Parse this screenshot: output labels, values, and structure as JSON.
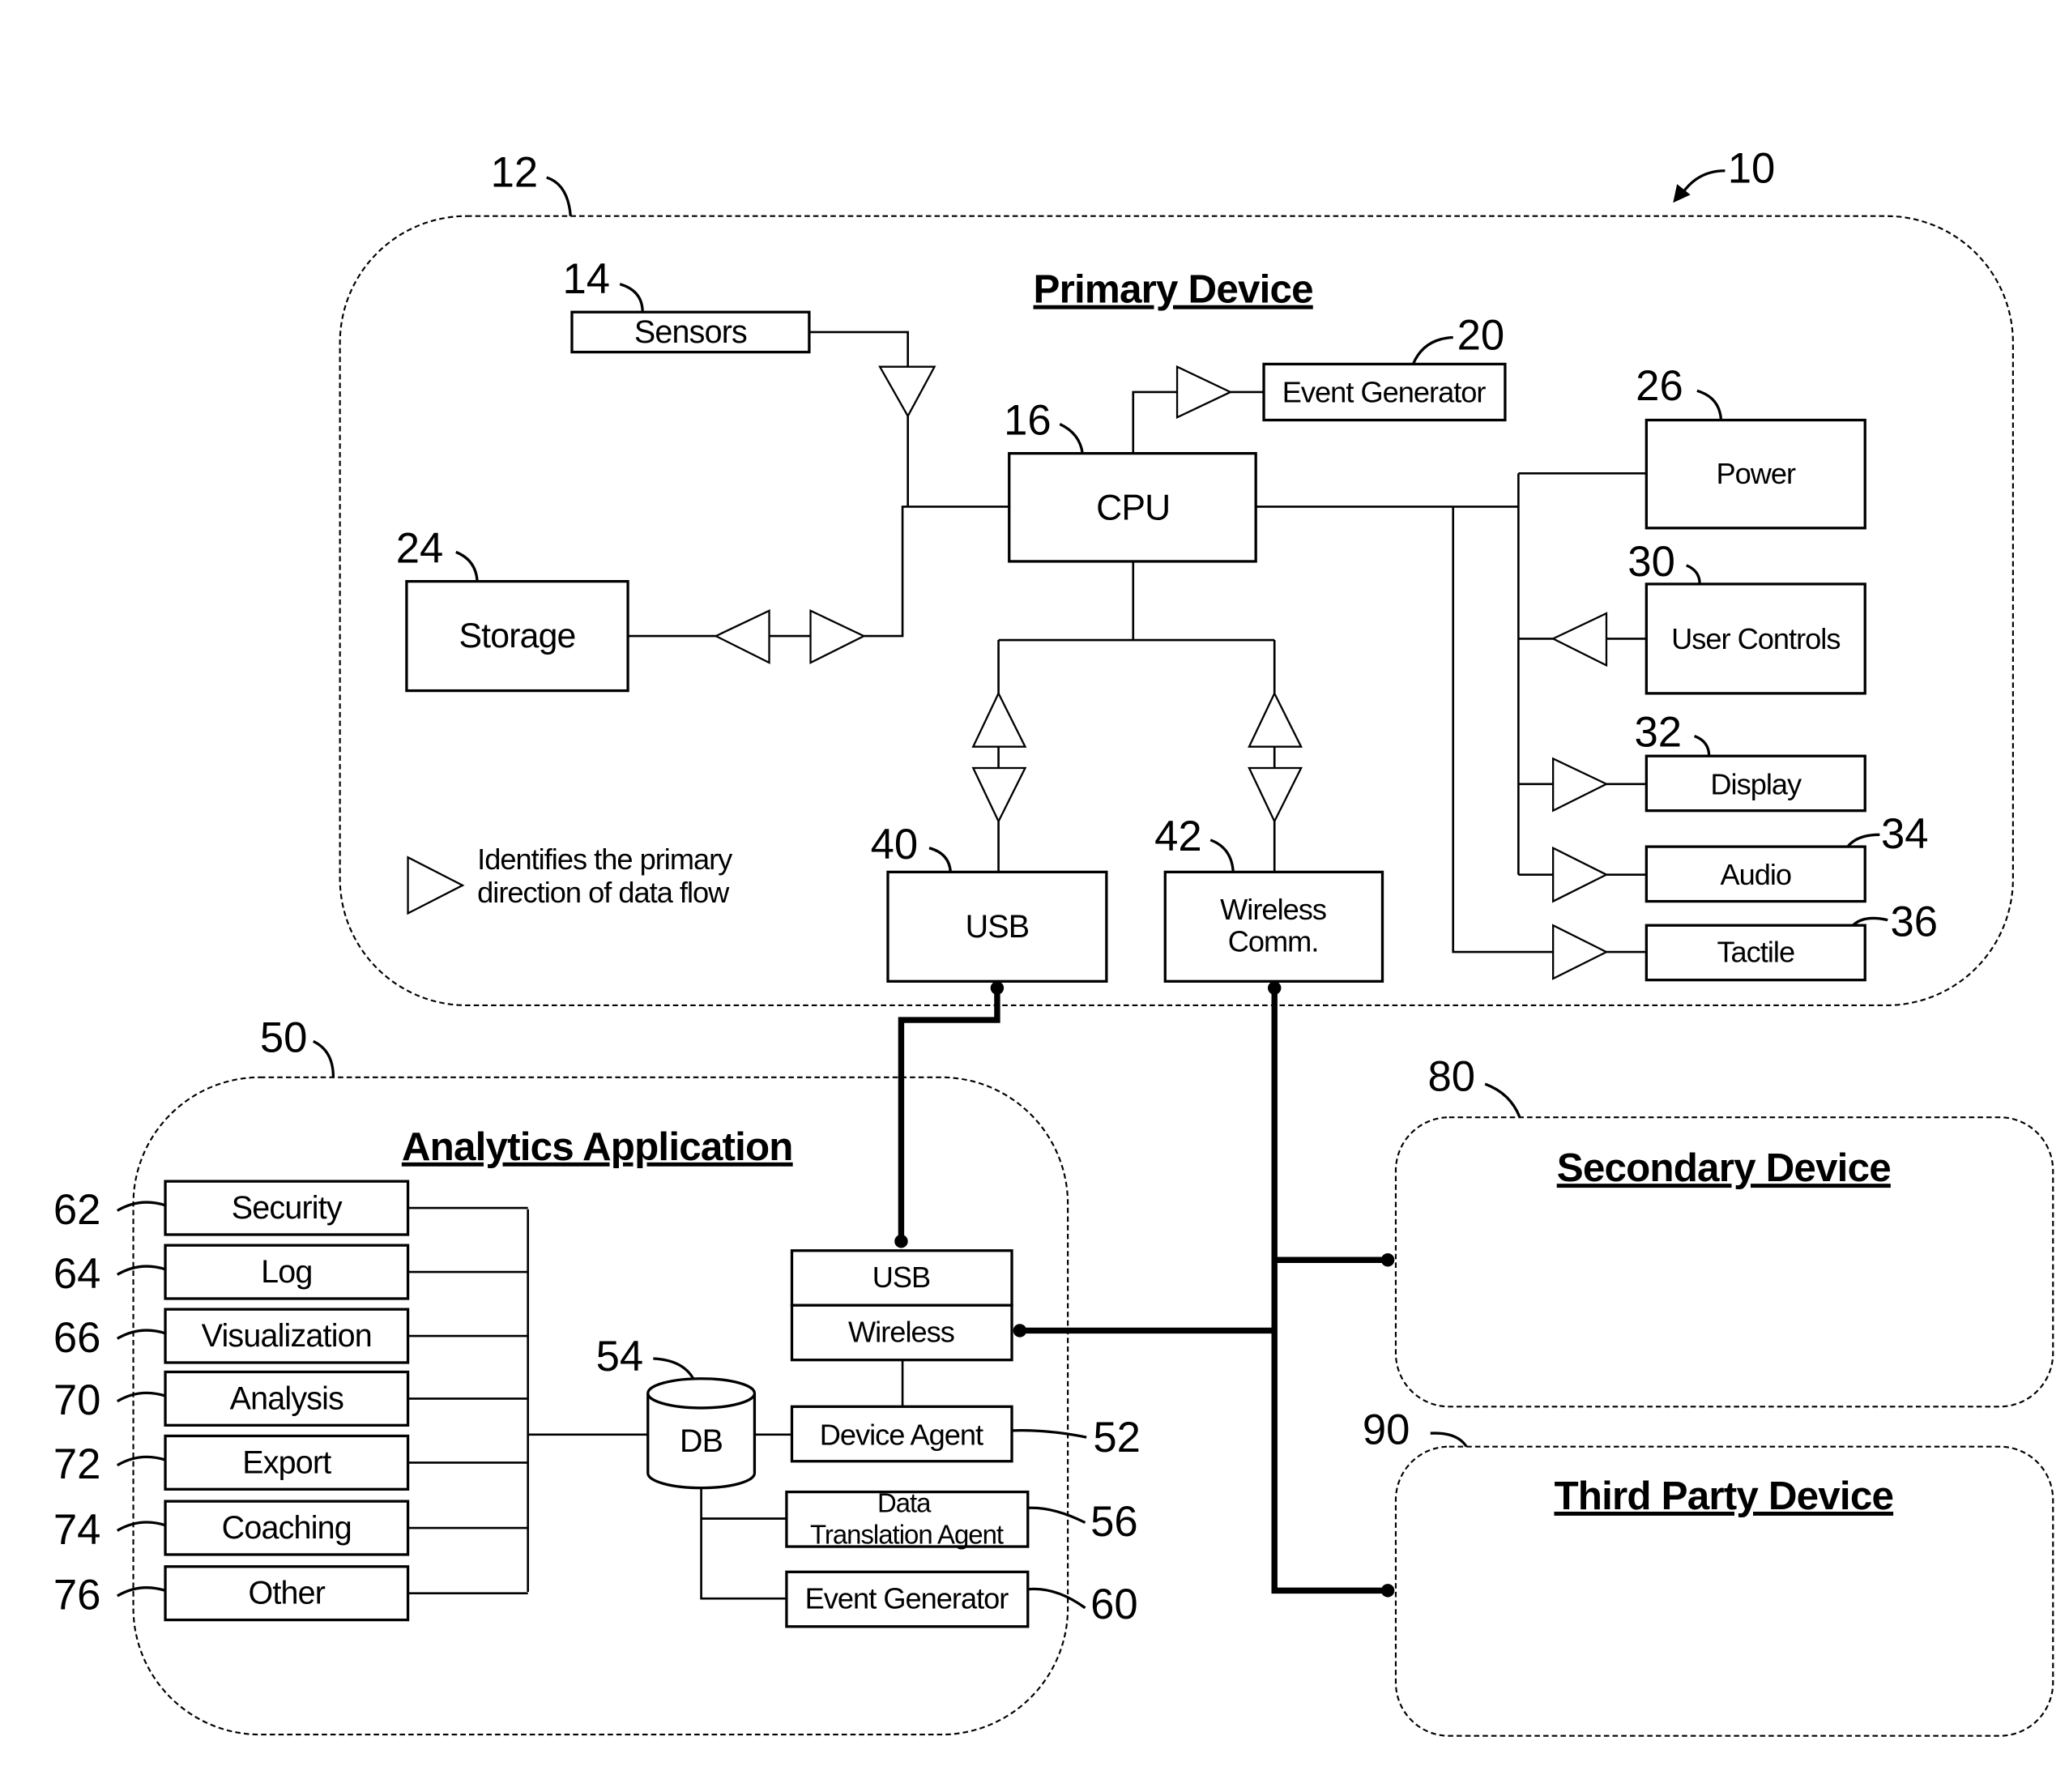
{
  "figure": {
    "reference": "10",
    "primary_device": {
      "reference": "12",
      "title": "Primary Device",
      "components": {
        "sensors": {
          "ref": "14",
          "label": "Sensors"
        },
        "cpu": {
          "ref": "16",
          "label": "CPU"
        },
        "event_generator": {
          "ref": "20",
          "label": "Event Generator"
        },
        "storage": {
          "ref": "24",
          "label": "Storage"
        },
        "power": {
          "ref": "26",
          "label": "Power"
        },
        "user_controls": {
          "ref": "30",
          "label": "User Controls"
        },
        "display": {
          "ref": "32",
          "label": "Display"
        },
        "audio": {
          "ref": "34",
          "label": "Audio"
        },
        "tactile": {
          "ref": "36",
          "label": "Tactile"
        },
        "usb": {
          "ref": "40",
          "label": "USB"
        },
        "wireless": {
          "ref": "42",
          "label_line1": "Wireless",
          "label_line2": "Comm."
        }
      },
      "legend": {
        "line1": "Identifies the primary",
        "line2": "direction of data flow",
        "symbol": "triangle-arrow-icon"
      }
    },
    "analytics_application": {
      "reference": "50",
      "title": "Analytics Application",
      "modules": [
        {
          "ref": "62",
          "label": "Security"
        },
        {
          "ref": "64",
          "label": "Log"
        },
        {
          "ref": "66",
          "label": "Visualization"
        },
        {
          "ref": "70",
          "label": "Analysis"
        },
        {
          "ref": "72",
          "label": "Export"
        },
        {
          "ref": "74",
          "label": "Coaching"
        },
        {
          "ref": "76",
          "label": "Other"
        }
      ],
      "db": {
        "ref": "54",
        "label": "DB"
      },
      "interface": {
        "usb_label": "USB",
        "wireless_label": "Wireless"
      },
      "device_agent": {
        "ref": "52",
        "label": "Device Agent"
      },
      "data_translation_agent": {
        "ref": "56",
        "label_line1": "Data",
        "label_line2": "Translation Agent"
      },
      "event_generator": {
        "ref": "60",
        "label": "Event Generator"
      }
    },
    "secondary_device": {
      "reference": "80",
      "title": "Secondary Device"
    },
    "third_party_device": {
      "reference": "90",
      "title": "Third Party Device"
    }
  }
}
